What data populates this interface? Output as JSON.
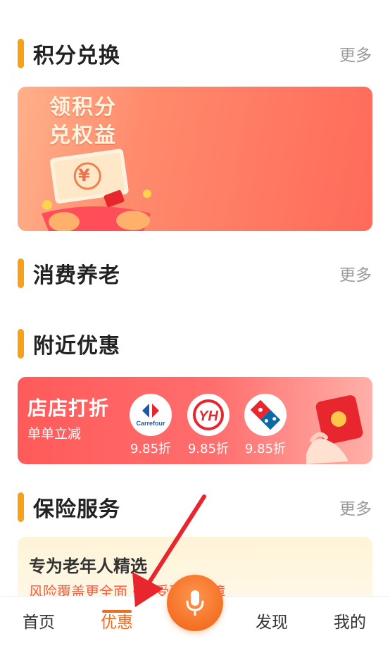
{
  "sections": {
    "points": {
      "title": "积分兑换",
      "more": "更多"
    },
    "pension": {
      "title": "消费养老",
      "more": "更多"
    },
    "nearby": {
      "title": "附近优惠"
    },
    "insurance": {
      "title": "保险服务",
      "more": "更多"
    }
  },
  "points_banner": {
    "line1": "领积分",
    "line2": "兑权益",
    "coin_symbol": "¥"
  },
  "discount_banner": {
    "title": "店店打折",
    "subtitle": "单单立减",
    "stores": [
      {
        "name": "Carrefour",
        "rate": "9.85折",
        "color": "#1d58a8"
      },
      {
        "name": "YH",
        "rate": "9.85折",
        "color": "#e8262d"
      },
      {
        "name": "Domino's Pizza",
        "rate": "9.85折",
        "color": "#0a6aa8"
      }
    ]
  },
  "insurance_card": {
    "title": "专为老年人精选",
    "subtitle": "风险覆盖更全面 · 享受更多保障"
  },
  "tabbar": {
    "home": "首页",
    "offers": "优惠",
    "discover": "发现",
    "mine": "我的",
    "active": "offers",
    "accent": "#f26b1d"
  }
}
